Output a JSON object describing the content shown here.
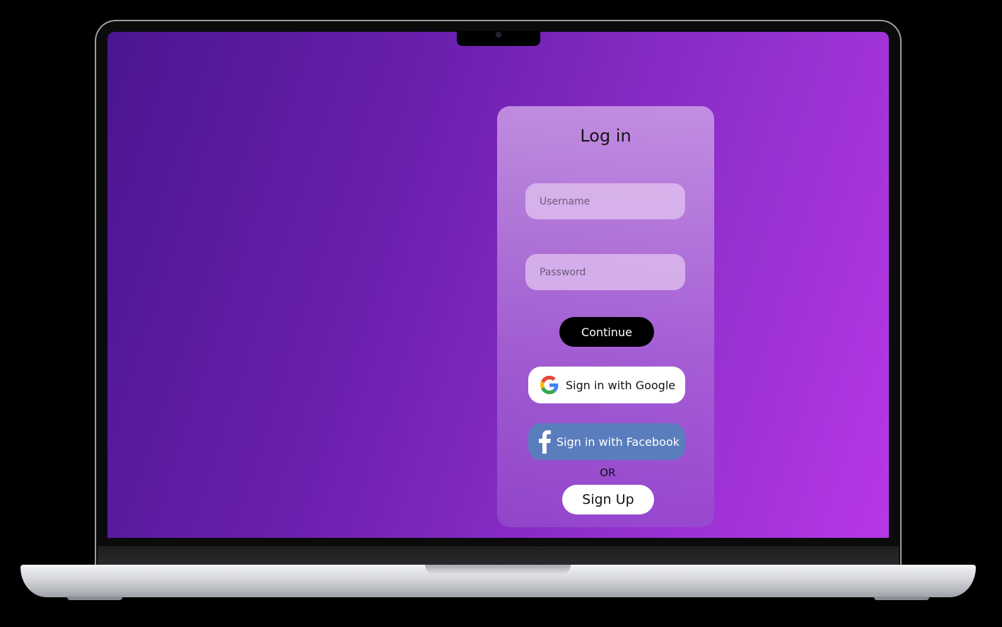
{
  "login": {
    "title": "Log in",
    "username_placeholder": "Username",
    "password_placeholder": "Password",
    "continue_label": "Continue",
    "google_label": "Sign in with Google",
    "facebook_label": "Sign in with Facebook",
    "or_text": "OR",
    "signup_label": "Sign Up"
  },
  "icons": {
    "google": "google-icon",
    "facebook": "facebook-icon"
  },
  "colors": {
    "background_start": "#4b1592",
    "background_end": "#b737e6",
    "facebook_button": "#5a7dbd",
    "continue_button": "#000000"
  }
}
